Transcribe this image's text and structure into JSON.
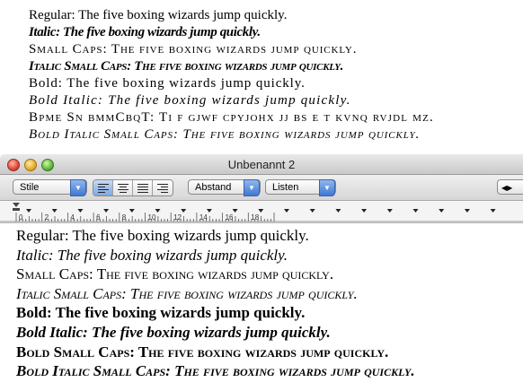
{
  "specimen": {
    "lines": [
      "Regular: The five boxing wizards jump quickly.",
      "Italic: The five boxing wizards jump quickly.",
      "Small Caps: The five boxing wizards jump quickly.",
      "Italic Small Caps: The five boxing wizards jump quickly.",
      "Bold: The five boxing wizards jump quickly.",
      "Bold Italic: The five boxing wizards jump quickly.",
      "Bpme Sn bmmCbqT: Ti f gjwf cpyjohx jj bs e t kvnq rvjdl mz.",
      "Bold Italic Small Caps: The five boxing wizards jump quickly."
    ]
  },
  "window": {
    "title": "Unbenannt 2",
    "toolbar": {
      "style_popup": "Stile",
      "spacing_popup": "Abstand",
      "lists_popup": "Listen"
    },
    "ruler": {
      "labels": [
        "0",
        "2",
        "4",
        "6",
        "8",
        "10",
        "12",
        "14",
        "16",
        "18"
      ]
    }
  },
  "document": {
    "lines": [
      "Regular: The five boxing wizards jump quickly.",
      "Italic: The five boxing wizards jump quickly.",
      "Small Caps: The five boxing wizards jump quickly.",
      "Italic Small Caps: The five boxing wizards jump quickly.",
      "Bold: The five boxing wizards jump quickly.",
      "Bold Italic: The five boxing wizards jump quickly.",
      "Bold Small Caps: The five boxing wizards jump quickly.",
      "Bold Italic Small Caps: The five boxing wizards jump quickly."
    ]
  },
  "colors": {
    "accent": "#3f78d4",
    "close": "#e0473a",
    "minimize": "#e8ac2a",
    "zoom": "#5fb53a"
  }
}
